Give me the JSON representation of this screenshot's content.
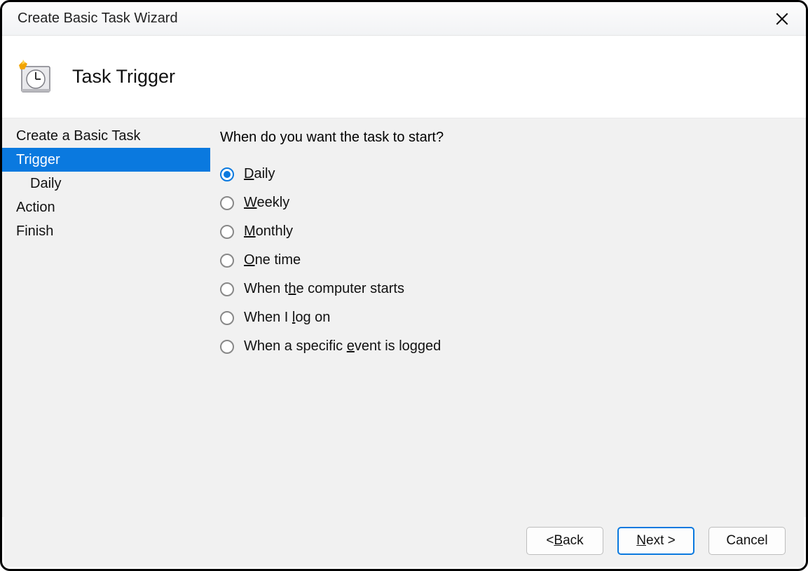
{
  "window": {
    "title": "Create Basic Task Wizard"
  },
  "header": {
    "title": "Task Trigger",
    "icon": "scheduled-task-icon"
  },
  "sidebar": {
    "steps": [
      {
        "label": "Create a Basic Task",
        "selected": false,
        "sub": false
      },
      {
        "label": "Trigger",
        "selected": true,
        "sub": false
      },
      {
        "label": "Daily",
        "selected": false,
        "sub": true
      },
      {
        "label": "Action",
        "selected": false,
        "sub": false
      },
      {
        "label": "Finish",
        "selected": false,
        "sub": false
      }
    ]
  },
  "content": {
    "question": "When do you want the task to start?",
    "options": [
      {
        "text": "Daily",
        "access_index": 0,
        "checked": true
      },
      {
        "text": "Weekly",
        "access_index": 0,
        "checked": false
      },
      {
        "text": "Monthly",
        "access_index": 0,
        "checked": false
      },
      {
        "text": "One time",
        "access_index": 0,
        "checked": false
      },
      {
        "text": "When the computer starts",
        "access_index": 6,
        "checked": false
      },
      {
        "text": "When I log on",
        "access_index": 7,
        "checked": false
      },
      {
        "text": "When a specific event is logged",
        "access_index": 16,
        "checked": false
      }
    ]
  },
  "footer": {
    "back": {
      "text": "Back",
      "prefix": "< ",
      "access_index": 0
    },
    "next": {
      "text": "Next",
      "suffix": " >",
      "access_index": 0
    },
    "cancel": {
      "text": "Cancel"
    }
  }
}
